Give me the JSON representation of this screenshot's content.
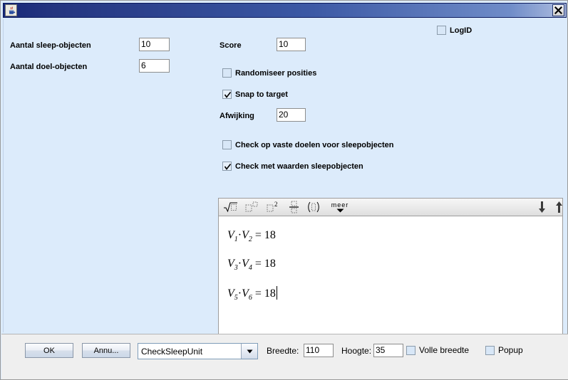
{
  "window": {
    "title": "",
    "icon": "java-cup-icon",
    "close_label": "X"
  },
  "form": {
    "fields": [
      {
        "label": "Aantal sleep-objecten",
        "value": "10"
      },
      {
        "label": "Aantal doel-objecten",
        "value": "6"
      },
      {
        "label": "Score",
        "value": "10"
      },
      {
        "label": "Afwijking",
        "value": "20"
      }
    ],
    "checkboxes": [
      {
        "label": "LogID",
        "checked": false
      },
      {
        "label": "Randomiseer posities",
        "checked": false
      },
      {
        "label": "Snap to target",
        "checked": true
      },
      {
        "label": "Check op vaste doelen voor sleepobjecten",
        "checked": false
      },
      {
        "label": "Check met waarden sleepobjecten",
        "checked": true
      }
    ]
  },
  "math_editor": {
    "toolbar": [
      {
        "name": "sqrt-icon",
        "label": "√□"
      },
      {
        "name": "power-icon",
        "label": "□□"
      },
      {
        "name": "square-icon",
        "label": "□²"
      },
      {
        "name": "fraction-icon",
        "label": "□/□"
      },
      {
        "name": "parentheses-icon",
        "label": "(□)"
      },
      {
        "name": "more-menu",
        "label": "meer"
      }
    ],
    "scroll_down_label": "↓",
    "scroll_up_label": "↑",
    "equations": [
      {
        "left1": "V",
        "sub1": "1",
        "left2": "V",
        "sub2": "2",
        "result": "18"
      },
      {
        "left1": "V",
        "sub1": "3",
        "left2": "V",
        "sub2": "4",
        "result": "18"
      },
      {
        "left1": "V",
        "sub1": "5",
        "left2": "V",
        "sub2": "6",
        "result": "18"
      }
    ],
    "operator": "·",
    "equals": "="
  },
  "footer": {
    "ok_label": "OK",
    "cancel_label": "Annu...",
    "unit_select": "CheckSleepUnit",
    "width_label": "Breedte:",
    "width_value": "110",
    "height_label": "Hoogte:",
    "height_value": "35",
    "full_width_label": "Volle breedte",
    "full_width_checked": false,
    "popup_label": "Popup",
    "popup_checked": false
  },
  "colors": {
    "panel_bg": "#dcebfb",
    "footer_bg": "#efefef",
    "title_dark": "#17297a",
    "title_light": "#aebde0"
  }
}
